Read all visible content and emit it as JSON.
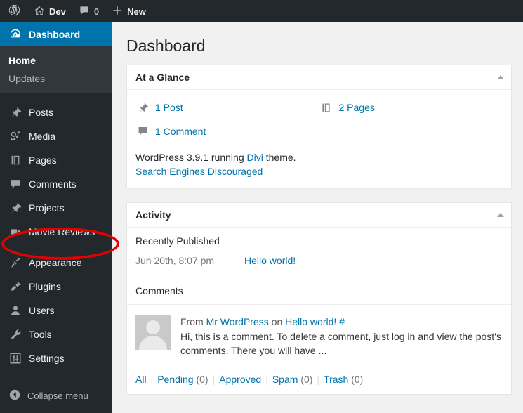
{
  "adminbar": {
    "logo_icon": "wordpress-logo-icon",
    "site_name": "Dev",
    "site_icon": "home-icon",
    "comments_icon": "comment-bubble-icon",
    "comments_count": "0",
    "new_icon": "plus-icon",
    "new_label": "New"
  },
  "sidebar": {
    "items": [
      {
        "label": "Dashboard",
        "icon": "dashboard-icon",
        "current": true
      },
      {
        "label": "Posts",
        "icon": "pushpin-icon",
        "current": false
      },
      {
        "label": "Media",
        "icon": "media-icon",
        "current": false
      },
      {
        "label": "Pages",
        "icon": "pages-icon",
        "current": false
      },
      {
        "label": "Comments",
        "icon": "comment-bubble-icon",
        "current": false
      },
      {
        "label": "Projects",
        "icon": "pushpin-icon",
        "current": false
      },
      {
        "label": "Movie Reviews",
        "icon": "video-camera-icon",
        "current": false
      },
      {
        "label": "Appearance",
        "icon": "paintbrush-icon",
        "current": false
      },
      {
        "label": "Plugins",
        "icon": "plug-icon",
        "current": false
      },
      {
        "label": "Users",
        "icon": "user-icon",
        "current": false
      },
      {
        "label": "Tools",
        "icon": "wrench-icon",
        "current": false
      },
      {
        "label": "Settings",
        "icon": "sliders-icon",
        "current": false
      }
    ],
    "submenu": [
      {
        "label": "Home",
        "current": true
      },
      {
        "label": "Updates",
        "current": false
      }
    ],
    "collapse": {
      "label": "Collapse menu",
      "icon": "collapse-arrow-icon"
    },
    "highlight_color": "#0073aa"
  },
  "main": {
    "page_title": "Dashboard",
    "at_a_glance": {
      "title": "At a Glance",
      "toggle_icon": "triangle-up-icon",
      "items": [
        {
          "label": "1 Post",
          "icon": "pushpin-icon"
        },
        {
          "label": "2 Pages",
          "icon": "pages-icon"
        },
        {
          "label": "1 Comment",
          "icon": "comment-bubble-icon"
        }
      ],
      "version_prefix": "WordPress 3.9.1 running ",
      "theme_name": "Divi",
      "version_suffix": " theme.",
      "search_engines": "Search Engines Discouraged"
    },
    "activity": {
      "title": "Activity",
      "toggle_icon": "triangle-up-icon",
      "recently_published": {
        "heading": "Recently Published",
        "date": "Jun 20th, 8:07 pm",
        "post_title": "Hello world!"
      },
      "comments": {
        "heading": "Comments",
        "avatar_icon": "avatar-placeholder-icon",
        "from_label": "From ",
        "author": "Mr WordPress",
        "on_label": " on ",
        "post_title": "Hello world!",
        "permalink": "#",
        "excerpt": "Hi, this is a comment. To delete a comment, just log in and view the post's comments. There you will have ...",
        "filters": [
          {
            "label": "All",
            "count": ""
          },
          {
            "label": "Pending",
            "count": "(0)"
          },
          {
            "label": "Approved",
            "count": ""
          },
          {
            "label": "Spam",
            "count": "(0)"
          },
          {
            "label": "Trash",
            "count": "(0)"
          }
        ]
      }
    }
  },
  "annotation": {
    "shape": "red-ellipse",
    "targets": "Movie Reviews",
    "color": "#e30000"
  }
}
